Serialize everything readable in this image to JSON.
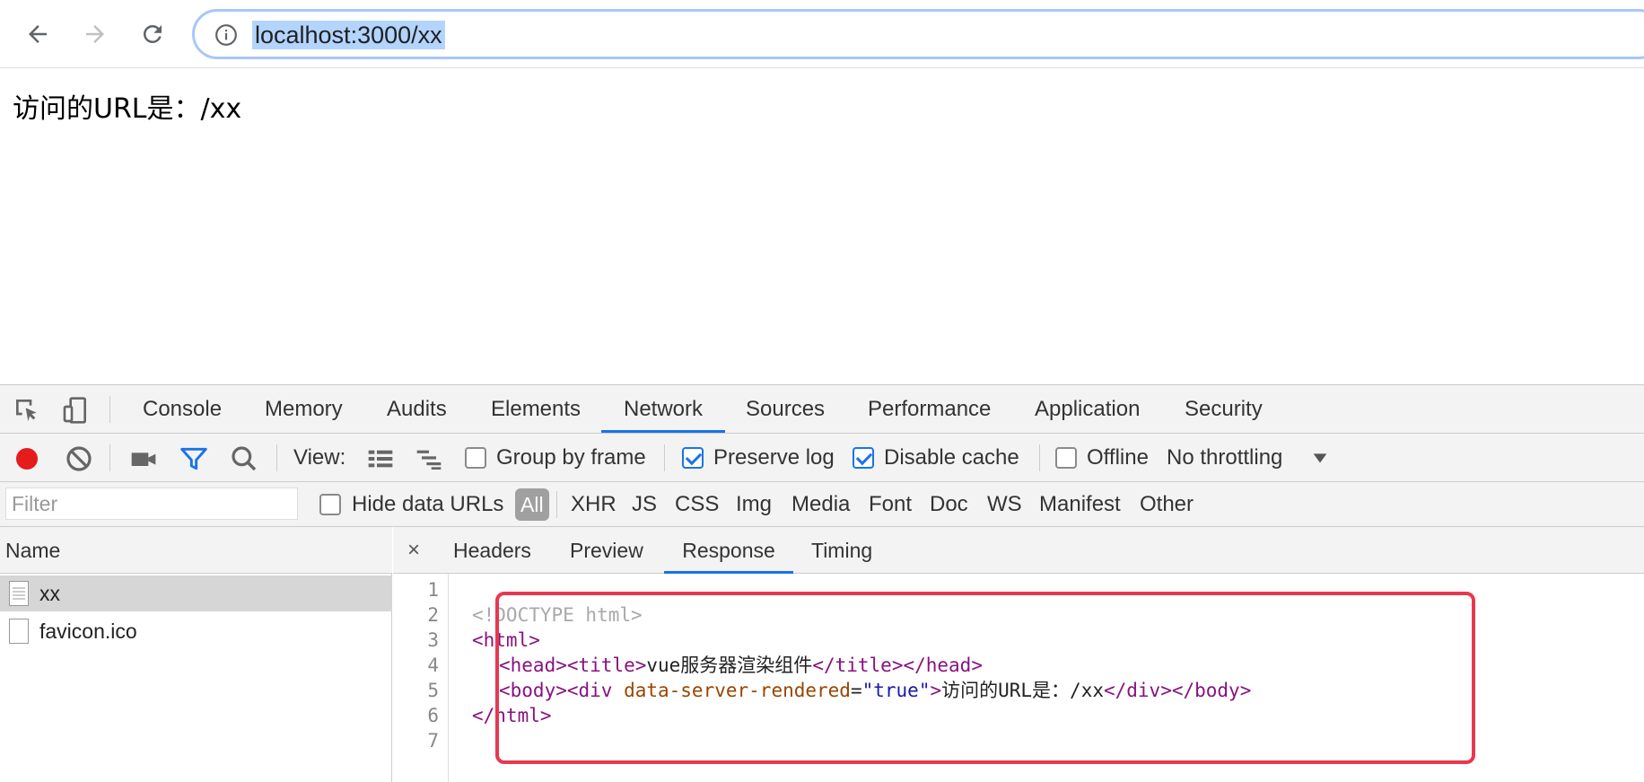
{
  "browser": {
    "url": "localhost:3000/xx",
    "back_icon": "arrow-left-icon",
    "forward_icon": "arrow-right-icon",
    "reload_icon": "reload-icon",
    "info_icon": "info-circle-icon"
  },
  "page": {
    "text": "访问的URL是：/xx"
  },
  "devtools": {
    "tabs": [
      "Console",
      "Memory",
      "Audits",
      "Elements",
      "Network",
      "Sources",
      "Performance",
      "Application",
      "Security"
    ],
    "active_tab": "Network",
    "network_toolbar": {
      "view_label": "View:",
      "group_by_frame": "Group by frame",
      "preserve_log": "Preserve log",
      "disable_cache": "Disable cache",
      "offline": "Offline",
      "throttling": "No throttling"
    },
    "filter": {
      "placeholder": "Filter",
      "hide_data_urls": "Hide data URLs",
      "types": [
        "All",
        "XHR",
        "JS",
        "CSS",
        "Img",
        "Media",
        "Font",
        "Doc",
        "WS",
        "Manifest",
        "Other"
      ]
    },
    "requests": {
      "header": "Name",
      "items": [
        "xx",
        "favicon.ico"
      ]
    },
    "detail_tabs": [
      "Headers",
      "Preview",
      "Response",
      "Timing"
    ],
    "active_detail_tab": "Response",
    "close_symbol": "×",
    "line_numbers": [
      "1",
      "2",
      "3",
      "4",
      "5",
      "6",
      "7"
    ],
    "response": {
      "l1": "<!DOCTYPE html>",
      "l2": "<html>",
      "l3_head_open": "<head><title>",
      "l3_title": "vue服务器渲染组件",
      "l3_head_close": "</title></head>",
      "l4_body_open": "<body><div ",
      "l4_attr": "data-server-rendered",
      "l4_eq": "=",
      "l4_val": "\"true\"",
      "l4_gt": ">",
      "l4_text": "访问的URL是：/xx",
      "l4_close": "</div></body>",
      "l5": "</html>"
    },
    "highlight_color": "#e8384f"
  }
}
